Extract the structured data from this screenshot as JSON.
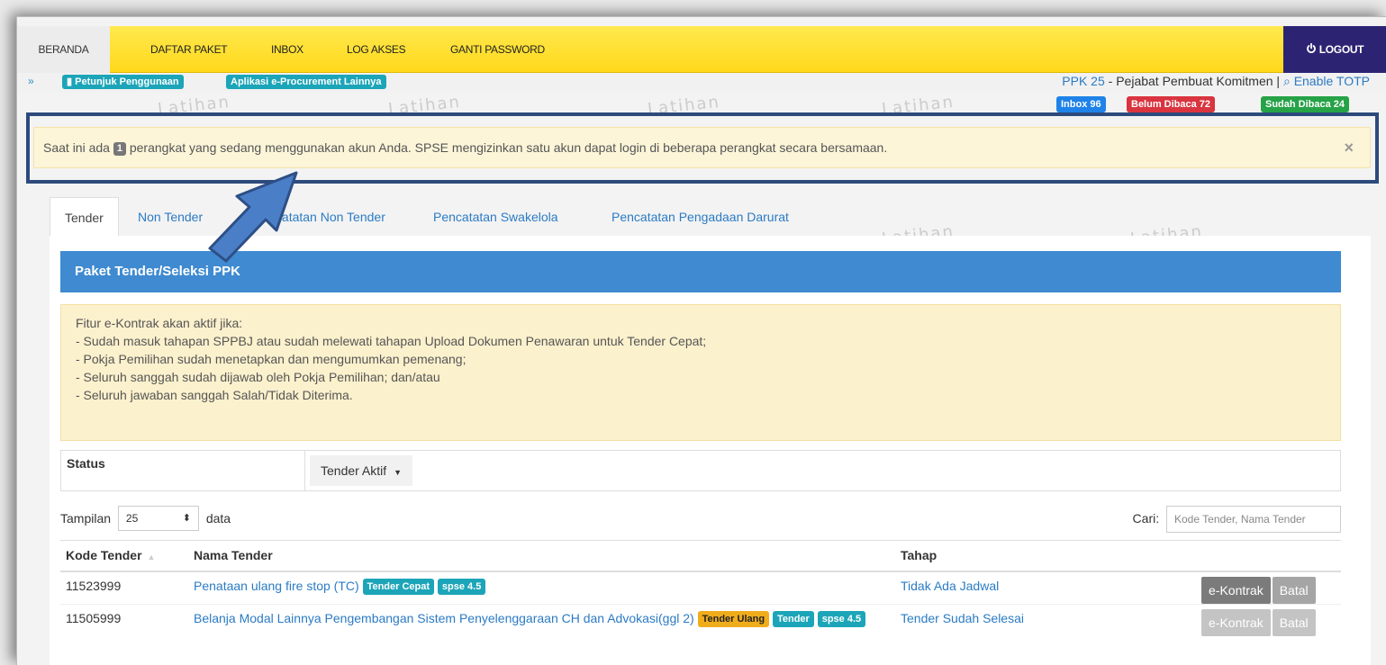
{
  "nav": {
    "items": [
      "BERANDA",
      "DAFTAR PAKET",
      "INBOX",
      "LOG AKSES",
      "GANTI PASSWORD"
    ],
    "logout": "LOGOUT"
  },
  "subbar": {
    "guide": "Petunjuk Penggunaan",
    "apps": "Aplikasi e-Procurement Lainnya",
    "user_link": "PPK 25",
    "user_role": " - Pejabat Pembuat Komitmen | ",
    "totp": "Enable TOTP"
  },
  "badges": {
    "inbox": "Inbox 96",
    "unread": "Belum Dibaca 72",
    "read": "Sudah Dibaca 24"
  },
  "watermark": "Latihan",
  "alert": {
    "prefix": "Saat ini ada",
    "count": "1",
    "suffix": "perangkat yang sedang menggunakan akun Anda. SPSE mengizinkan satu akun dapat login di beberapa perangkat secara bersamaan.",
    "close": "×"
  },
  "tabs": [
    "Tender",
    "Non Tender",
    "Pencatatan Non Tender",
    "Pencatatan Swakelola",
    "Pencatatan Pengadaan Darurat"
  ],
  "panel_title": "Paket Tender/Seleksi PPK",
  "notice": [
    "Fitur e-Kontrak akan aktif jika:",
    "- Sudah masuk tahapan SPPBJ atau sudah melewati tahapan Upload Dokumen Penawaran untuk Tender Cepat;",
    "- Pokja Pemilihan sudah menetapkan dan mengumumkan pemenang;",
    "- Seluruh sanggah sudah dijawab oleh Pokja Pemilihan; dan/atau",
    "- Seluruh jawaban sanggah Salah/Tidak Diterima."
  ],
  "status": {
    "label": "Status",
    "value": "Tender Aktif"
  },
  "length": {
    "prefix": "Tampilan",
    "value": "25",
    "suffix": "data"
  },
  "search": {
    "label": "Cari:",
    "placeholder": "Kode Tender, Nama Tender"
  },
  "table": {
    "headers": [
      "Kode Tender",
      "Nama Tender",
      "Tahap",
      ""
    ],
    "rows": [
      {
        "kode": "11523999",
        "nama": "Penataan ulang fire stop (TC)",
        "labels": [
          "Tender Cepat",
          "spse 4.5"
        ],
        "tahap": "Tidak Ada Jadwal",
        "actions": [
          "e-Kontrak",
          "Batal"
        ]
      },
      {
        "kode": "11505999",
        "nama": "Belanja Modal Lainnya Pengembangan Sistem Penyelenggaraan CH dan Advokasi(ggl 2)",
        "labels": [
          "Tender Ulang",
          "Tender",
          "spse 4.5"
        ],
        "tahap": "Tender Sudah Selesai",
        "actions": [
          "e-Kontrak",
          "Batal"
        ]
      }
    ]
  },
  "colors": {
    "navbar": "#ffd81a",
    "logout": "#2c2473",
    "panel": "#3f8ad0",
    "teal": "#1ca5b8",
    "link": "#2b7bc4",
    "highlight": "#2d4a7c"
  }
}
